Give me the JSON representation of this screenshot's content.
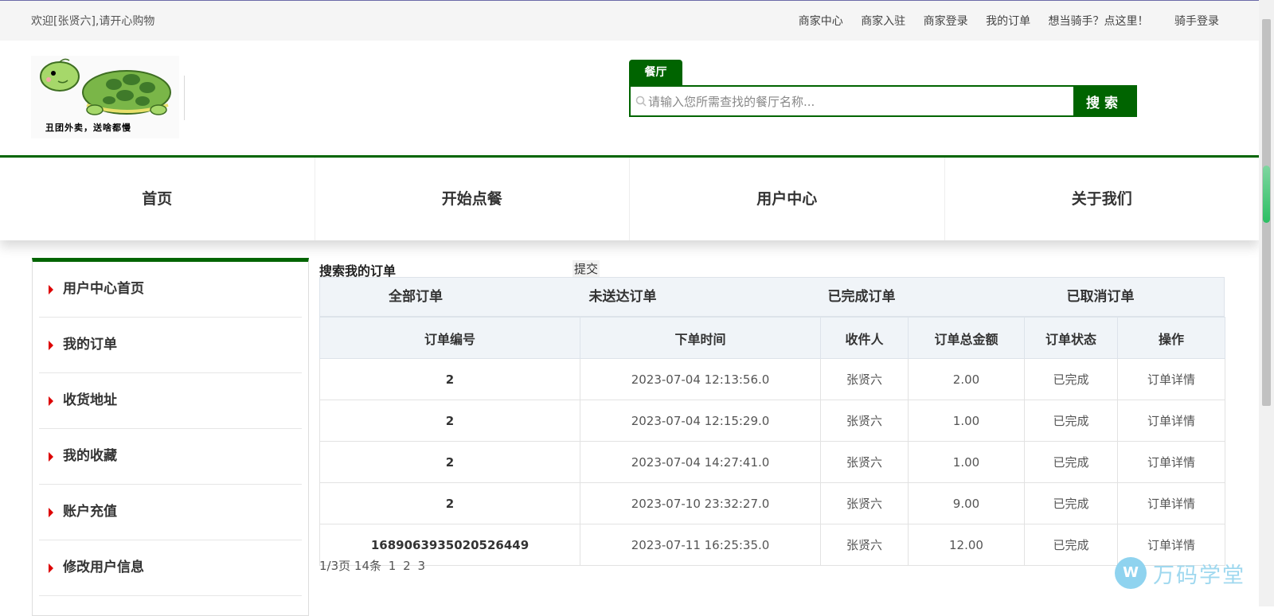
{
  "topbar": {
    "welcome": "欢迎[张贤六],请开心购物",
    "links": [
      "商家中心",
      "商家入驻",
      "商家登录",
      "我的订单",
      "想当骑手？点这里！",
      "骑手登录"
    ]
  },
  "logo": {
    "caption": "丑团外卖，送啥都慢"
  },
  "search": {
    "tab": "餐厅",
    "placeholder": "请输入您所需查找的餐厅名称...",
    "button": "搜索"
  },
  "nav": [
    "首页",
    "开始点餐",
    "用户中心",
    "关于我们"
  ],
  "sidebar": [
    "用户中心首页",
    "我的订单",
    "收货地址",
    "我的收藏",
    "账户充值",
    "修改用户信息"
  ],
  "main": {
    "title": "搜索我的订单",
    "submit": "提交",
    "tabs": [
      "全部订单",
      "未送达订单",
      "已完成订单",
      "已取消订单"
    ],
    "columns": [
      "订单编号",
      "下单时间",
      "收件人",
      "订单总金额",
      "订单状态",
      "操作"
    ],
    "rows": [
      {
        "id": "2",
        "time": "2023-07-04 12:13:56.0",
        "receiver": "张贤六",
        "amount": "2.00",
        "status": "已完成",
        "op": "订单详情"
      },
      {
        "id": "2",
        "time": "2023-07-04 12:15:29.0",
        "receiver": "张贤六",
        "amount": "1.00",
        "status": "已完成",
        "op": "订单详情"
      },
      {
        "id": "2",
        "time": "2023-07-04 14:27:41.0",
        "receiver": "张贤六",
        "amount": "1.00",
        "status": "已完成",
        "op": "订单详情"
      },
      {
        "id": "2",
        "time": "2023-07-10 23:32:27.0",
        "receiver": "张贤六",
        "amount": "9.00",
        "status": "已完成",
        "op": "订单详情"
      },
      {
        "id": "1689063935020526449",
        "time": "2023-07-11 16:25:35.0",
        "receiver": "张贤六",
        "amount": "12.00",
        "status": "已完成",
        "op": "订单详情"
      }
    ],
    "pager": {
      "info": "1/3页 14条",
      "pages": [
        "1",
        "2",
        "3"
      ]
    }
  },
  "watermark": {
    "icon": "W",
    "text": "万码学堂"
  },
  "colors": {
    "primary": "#006400",
    "arrow": "#dd0000"
  }
}
